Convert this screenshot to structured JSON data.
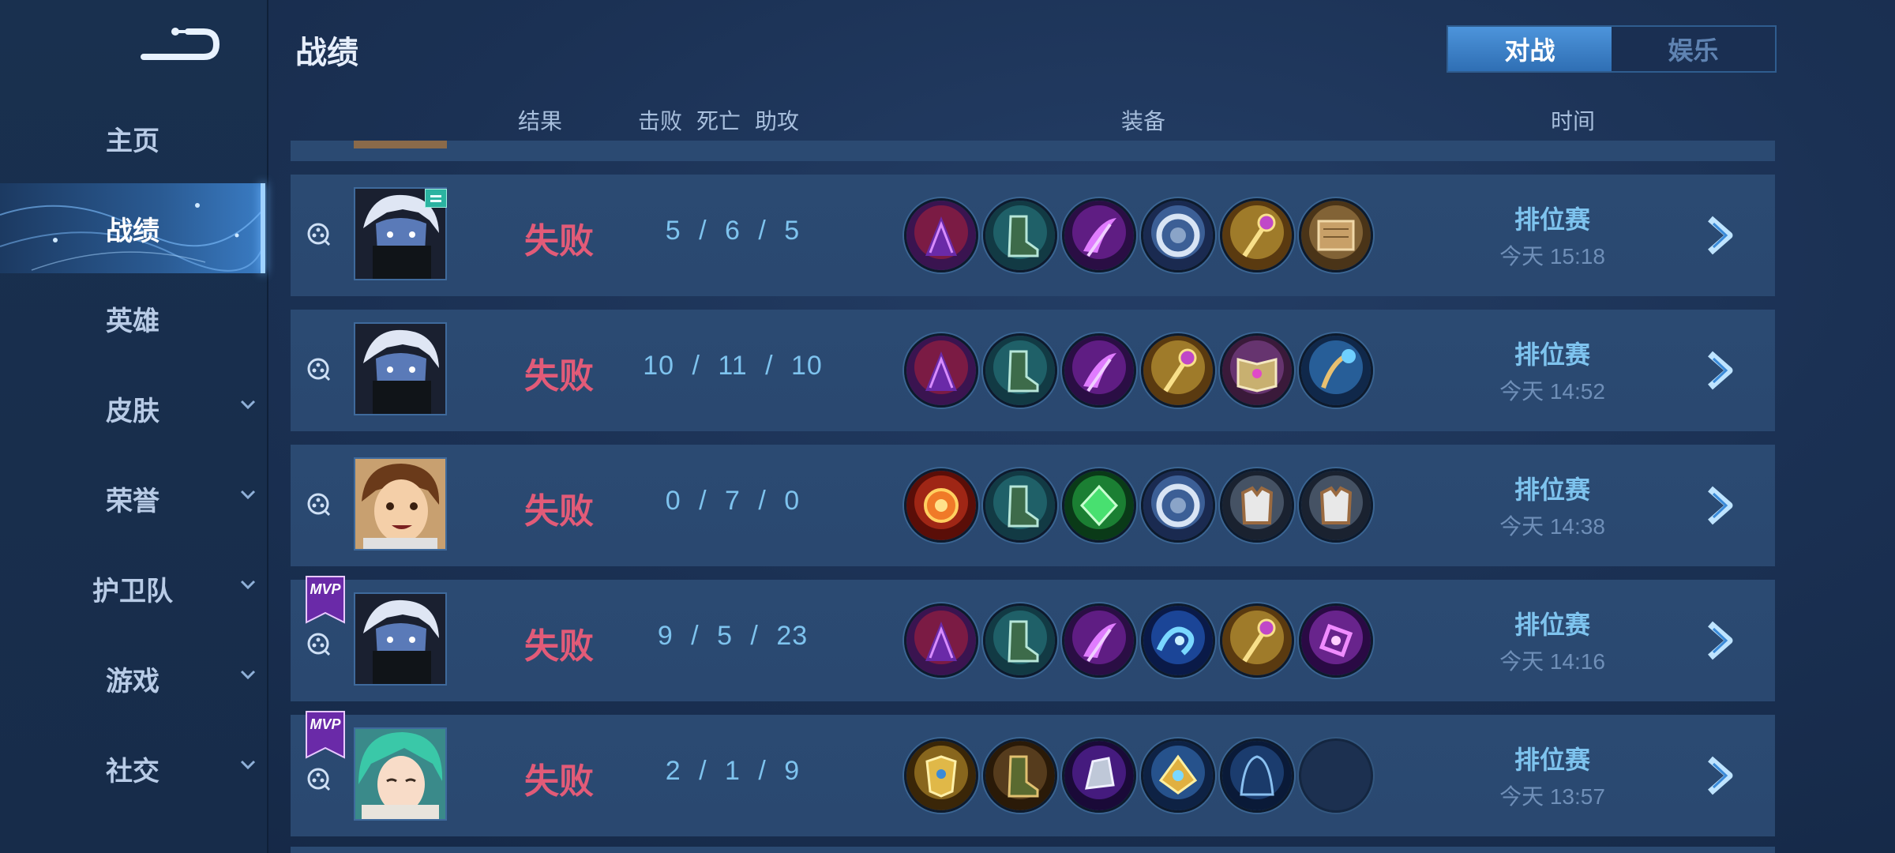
{
  "sidebar": {
    "items": [
      {
        "label": "主页",
        "has_chevron": false,
        "active": false
      },
      {
        "label": "战绩",
        "has_chevron": false,
        "active": true
      },
      {
        "label": "英雄",
        "has_chevron": false,
        "active": false
      },
      {
        "label": "皮肤",
        "has_chevron": true,
        "active": false
      },
      {
        "label": "荣誉",
        "has_chevron": true,
        "active": false
      },
      {
        "label": "护卫队",
        "has_chevron": true,
        "active": false
      },
      {
        "label": "游戏",
        "has_chevron": true,
        "active": false
      },
      {
        "label": "社交",
        "has_chevron": true,
        "active": false
      }
    ]
  },
  "header": {
    "title": "战绩",
    "tabs": [
      {
        "label": "对战",
        "active": true
      },
      {
        "label": "娱乐",
        "active": false
      }
    ]
  },
  "columns": {
    "result": "结果",
    "kda_kills": "击败",
    "kda_deaths": "死亡",
    "kda_assists": "助攻",
    "equipment": "装备",
    "time": "时间"
  },
  "matches": [
    {
      "mvp": false,
      "rank_badge": true,
      "hero_avatar": "dark-masked-hero",
      "result": "失败",
      "kda": "5 / 6 / 5",
      "items": [
        "purple-cape-item",
        "teal-boots-item",
        "purple-scythe-item",
        "silver-shield-item",
        "golden-staff-item",
        "wooden-tome-item"
      ],
      "mode": "排位赛",
      "time": "今天 15:18"
    },
    {
      "mvp": false,
      "rank_badge": false,
      "hero_avatar": "dark-masked-hero",
      "result": "失败",
      "kda": "10 / 11 / 10",
      "items": [
        "purple-cape-item",
        "teal-boots-item",
        "purple-scythe-item",
        "golden-staff-item",
        "spell-book-item",
        "blue-wand-item"
      ],
      "mode": "排位赛",
      "time": "今天 14:52"
    },
    {
      "mvp": false,
      "rank_badge": false,
      "hero_avatar": "brown-hair-hero",
      "result": "失败",
      "kda": "0 / 7 / 0",
      "items": [
        "red-orb-item",
        "teal-boots-item",
        "green-gem-item",
        "silver-shield-item",
        "armor-vest-item",
        "armor-vest-item"
      ],
      "mode": "排位赛",
      "time": "今天 14:38"
    },
    {
      "mvp": true,
      "rank_badge": false,
      "hero_avatar": "dark-masked-hero",
      "result": "失败",
      "kda": "9 / 5 / 23",
      "items": [
        "purple-cape-item",
        "teal-boots-item",
        "purple-scythe-item",
        "blue-wave-item",
        "golden-staff-item",
        "purple-glyph-item"
      ],
      "mode": "排位赛",
      "time": "今天 14:16"
    },
    {
      "mvp": true,
      "rank_badge": false,
      "hero_avatar": "green-hair-hero",
      "result": "失败",
      "kda": "2 / 1 / 9",
      "items": [
        "golden-armor-item",
        "leather-boots-item",
        "dark-gauntlet-item",
        "gold-crest-item",
        "hooded-cloak-item",
        "empty-slot"
      ],
      "mode": "排位赛",
      "time": "今天 13:57"
    }
  ],
  "mvp_label": "MVP",
  "colors": {
    "accent_blue": "#4d94db",
    "defeat_red": "#e25b78",
    "kda_blue": "#7ec3ee",
    "row_bg": "#2b4a72"
  }
}
